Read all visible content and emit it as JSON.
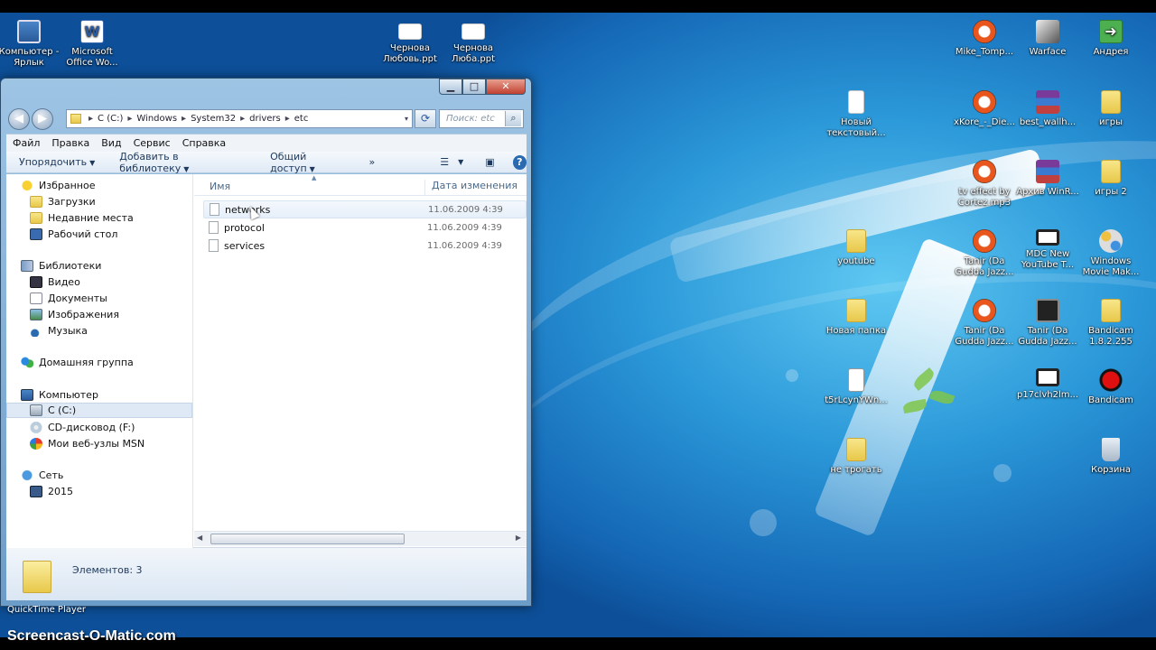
{
  "desktop": {
    "icons": [
      {
        "label": "Компьютер - Ярлык",
        "icon": "computer-icon"
      },
      {
        "label": "Microsoft Office Wo...",
        "icon": "word-icon"
      },
      {
        "label": "Чернова Любовь.ppt",
        "icon": "document-icon"
      },
      {
        "label": "Чернова Люба.ppt",
        "icon": "document-icon"
      },
      {
        "label": "Mike_Tomp...",
        "icon": "mp3-icon"
      },
      {
        "label": "Warface",
        "icon": "warface-icon"
      },
      {
        "label": "Андрея",
        "icon": "green-arrow-icon"
      },
      {
        "label": "Новый текстовый...",
        "icon": "text-file-icon"
      },
      {
        "label": "xKore_-_Die...",
        "icon": "mp3-icon"
      },
      {
        "label": "best_wallh...",
        "icon": "winrar-icon"
      },
      {
        "label": "игры",
        "icon": "folder-icon"
      },
      {
        "label": "tv effect by Cortez.mp3",
        "icon": "mp3-icon"
      },
      {
        "label": "Архив WinR...",
        "icon": "winrar-icon"
      },
      {
        "label": "игры 2",
        "icon": "folder-icon"
      },
      {
        "label": "youtube",
        "icon": "folder-icon"
      },
      {
        "label": "Tanir (Da Gudda Jazz...",
        "icon": "mp3-icon"
      },
      {
        "label": "MDC New YouTube T...",
        "icon": "video-icon"
      },
      {
        "label": "Windows Movie Mak...",
        "icon": "movie-maker-icon"
      },
      {
        "label": "Новая папка",
        "icon": "folder-icon"
      },
      {
        "label": "Tanir (Da Gudda Jazz...",
        "icon": "mp3-icon"
      },
      {
        "label": "Tanir (Da Gudda Jazz...",
        "icon": "dark-image-icon"
      },
      {
        "label": "Bandicam 1.8.2.255",
        "icon": "folder-icon"
      },
      {
        "label": "t5rLcynYWn...",
        "icon": "shortcut-icon"
      },
      {
        "label": "p17clvh2lm...",
        "icon": "video-icon"
      },
      {
        "label": "Bandicam",
        "icon": "bandicam-icon"
      },
      {
        "label": "не трогать",
        "icon": "folder-icon"
      },
      {
        "label": "Корзина",
        "icon": "recycle-bin-icon"
      }
    ],
    "quicktime_label": "QuickTime Player"
  },
  "window": {
    "buttons": {
      "minimize": "▁",
      "maximize": "□",
      "close": "✕"
    },
    "nav": {
      "back": "◀",
      "forward": "▶"
    },
    "address": {
      "segments": [
        "C (C:)",
        "Windows",
        "System32",
        "drivers",
        "etc"
      ],
      "separator": "▸",
      "dropdown": "▾"
    },
    "refresh": "⟳",
    "search": {
      "placeholder": "Поиск: etc",
      "icon": "⌕"
    },
    "menu": [
      "Файл",
      "Правка",
      "Вид",
      "Сервис",
      "Справка"
    ],
    "commands": {
      "organize": "Упорядочить",
      "include_library": "Добавить в библиотеку",
      "share": "Общий доступ",
      "more": "»",
      "arrow": "▼",
      "views": "☰",
      "preview": "▣",
      "help": "?"
    },
    "nav_tree": {
      "favorites": "Избранное",
      "downloads": "Загрузки",
      "recent": "Недавние места",
      "desktop": "Рабочий стол",
      "libraries": "Библиотеки",
      "video": "Видео",
      "documents": "Документы",
      "images": "Изображения",
      "music": "Музыка",
      "homegroup": "Домашняя группа",
      "computer": "Компьютер",
      "drive_c": "C (C:)",
      "cd_drive": "CD-дисковод (F:)",
      "msn": "Мои веб-узлы MSN",
      "network": "Сеть",
      "network_pc": "2015"
    },
    "columns": {
      "name": "Имя",
      "date": "Дата изменения",
      "sort_indicator": "▲"
    },
    "files": [
      {
        "name": "networks",
        "date": "11.06.2009 4:39"
      },
      {
        "name": "protocol",
        "date": "11.06.2009 4:39"
      },
      {
        "name": "services",
        "date": "11.06.2009 4:39"
      }
    ],
    "scroll": {
      "left": "◀",
      "right": "▶"
    },
    "status": {
      "items_count": "Элементов: 3"
    }
  },
  "watermark": "Screencast-O-Matic.com"
}
